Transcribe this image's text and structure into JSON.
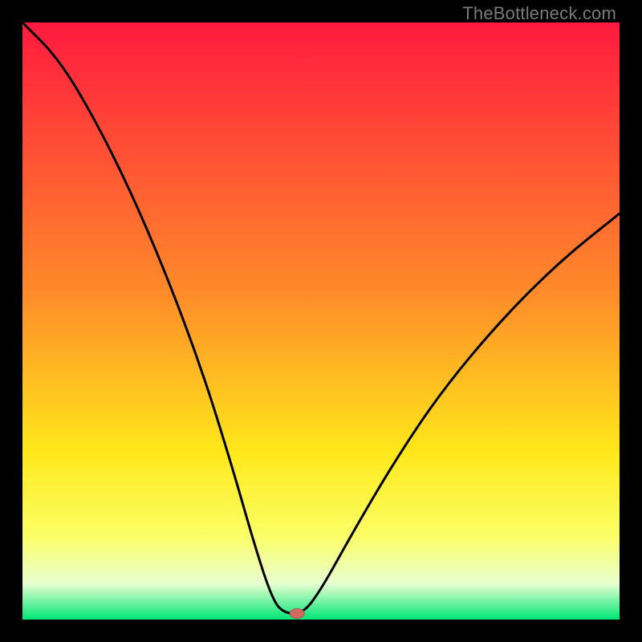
{
  "watermark": "TheBottleneck.com",
  "colors": {
    "black": "#000000",
    "curve": "#000000",
    "marker_fill": "#d46a5f",
    "marker_stroke": "#b65248",
    "grad_top": "#ff1a3f",
    "grad_mid1": "#ff8a2a",
    "grad_mid2": "#ffe81a",
    "grad_band": "#fbff66",
    "grad_low": "#e8ffd0",
    "grad_bottom": "#00e676"
  },
  "chart_data": {
    "type": "line",
    "title": "",
    "xlabel": "",
    "ylabel": "",
    "xlim": [
      0,
      100
    ],
    "ylim": [
      0,
      100
    ],
    "notch_x": 44,
    "marker": {
      "x": 46,
      "y": 1
    },
    "curve_percent": [
      {
        "x": 0,
        "y": 100
      },
      {
        "x": 6,
        "y": 94
      },
      {
        "x": 12,
        "y": 84
      },
      {
        "x": 18,
        "y": 72
      },
      {
        "x": 24,
        "y": 58
      },
      {
        "x": 30,
        "y": 42
      },
      {
        "x": 35,
        "y": 26
      },
      {
        "x": 39,
        "y": 12
      },
      {
        "x": 42,
        "y": 3
      },
      {
        "x": 44,
        "y": 1
      },
      {
        "x": 47,
        "y": 1
      },
      {
        "x": 50,
        "y": 5
      },
      {
        "x": 55,
        "y": 14
      },
      {
        "x": 62,
        "y": 26
      },
      {
        "x": 70,
        "y": 38
      },
      {
        "x": 80,
        "y": 50
      },
      {
        "x": 90,
        "y": 60
      },
      {
        "x": 100,
        "y": 68
      }
    ],
    "gradient_stops_percent": [
      {
        "pos": 0,
        "key": "grad_top"
      },
      {
        "pos": 45,
        "key": "grad_mid1"
      },
      {
        "pos": 72,
        "key": "grad_mid2"
      },
      {
        "pos": 86,
        "key": "grad_band"
      },
      {
        "pos": 94,
        "key": "grad_low"
      },
      {
        "pos": 100,
        "key": "grad_bottom"
      }
    ]
  }
}
